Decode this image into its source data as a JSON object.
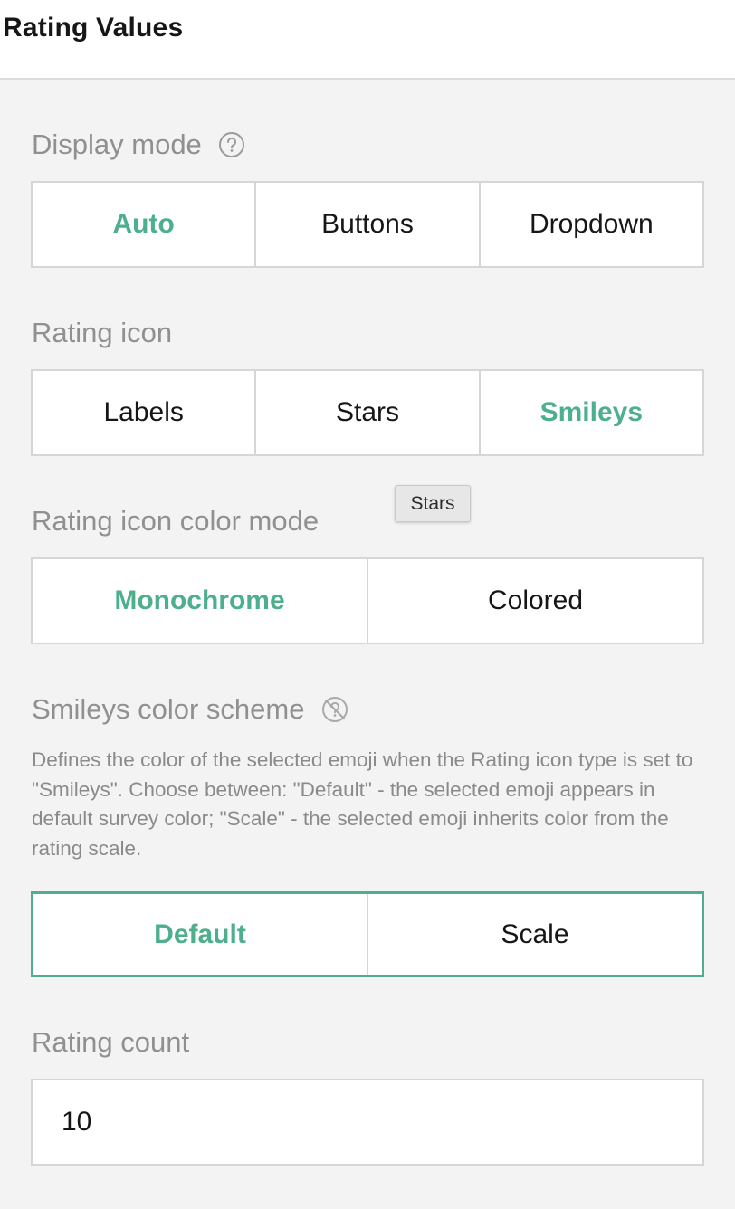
{
  "header": {
    "title": "Rating Values"
  },
  "display_mode": {
    "label": "Display mode",
    "help_icon": "question-circle-icon",
    "options": [
      "Auto",
      "Buttons",
      "Dropdown"
    ],
    "selected": "Auto"
  },
  "rating_icon": {
    "label": "Rating icon",
    "options": [
      "Labels",
      "Stars",
      "Smileys"
    ],
    "selected": "Smileys"
  },
  "tooltip": {
    "text": "Stars"
  },
  "rating_icon_color_mode": {
    "label": "Rating icon color mode",
    "options": [
      "Monochrome",
      "Colored"
    ],
    "selected": "Monochrome"
  },
  "smileys_color_scheme": {
    "label": "Smileys color scheme",
    "hide_help_icon": "help-hidden-icon",
    "description": "Defines the color of the selected emoji when the Rating icon type is set to \"Smileys\". Choose between: \"Default\" - the selected emoji appears in default survey color; \"Scale\" - the selected emoji inherits color from the rating scale.",
    "options": [
      "Default",
      "Scale"
    ],
    "selected": "Default"
  },
  "rating_count": {
    "label": "Rating count",
    "value": "10"
  },
  "colors": {
    "accent": "#4daf8c",
    "background": "#f3f3f3",
    "label": "#909090",
    "border": "#d6d6d6"
  }
}
